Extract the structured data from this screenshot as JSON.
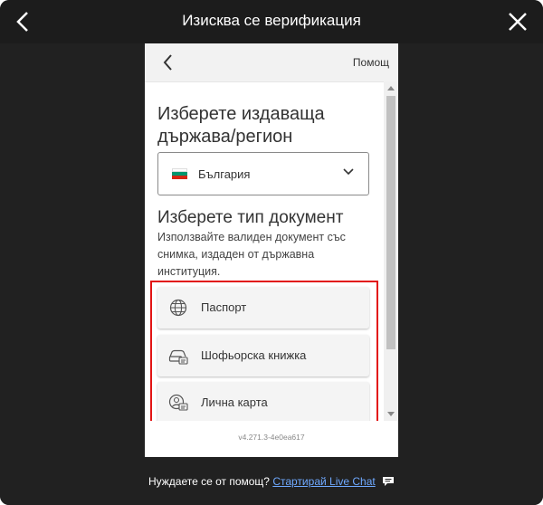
{
  "header": {
    "title": "Изисква се верификация"
  },
  "panel": {
    "help_label": "Помощ",
    "country_heading": "Изберете издаваща държава/регион",
    "country_select": {
      "value": "България",
      "flag_colors": [
        "#ffffff",
        "#00966e",
        "#d62612"
      ]
    },
    "doc_heading": "Изберете тип документ",
    "doc_description": "Използвайте валиден документ със снимка, издаден от държавна институция.",
    "options": [
      {
        "label": "Паспорт",
        "icon": "globe-icon"
      },
      {
        "label": "Шофьорска книжка",
        "icon": "car-license-icon"
      },
      {
        "label": "Лична карта",
        "icon": "id-card-icon"
      }
    ],
    "version": "v4.271.3-4e0ea617"
  },
  "footer": {
    "prompt": "Нуждаете се от помощ?",
    "link_label": "Стартирай Live Chat"
  },
  "colors": {
    "highlight": "#e21414",
    "link": "#6fa9ff",
    "background": "#212121"
  }
}
